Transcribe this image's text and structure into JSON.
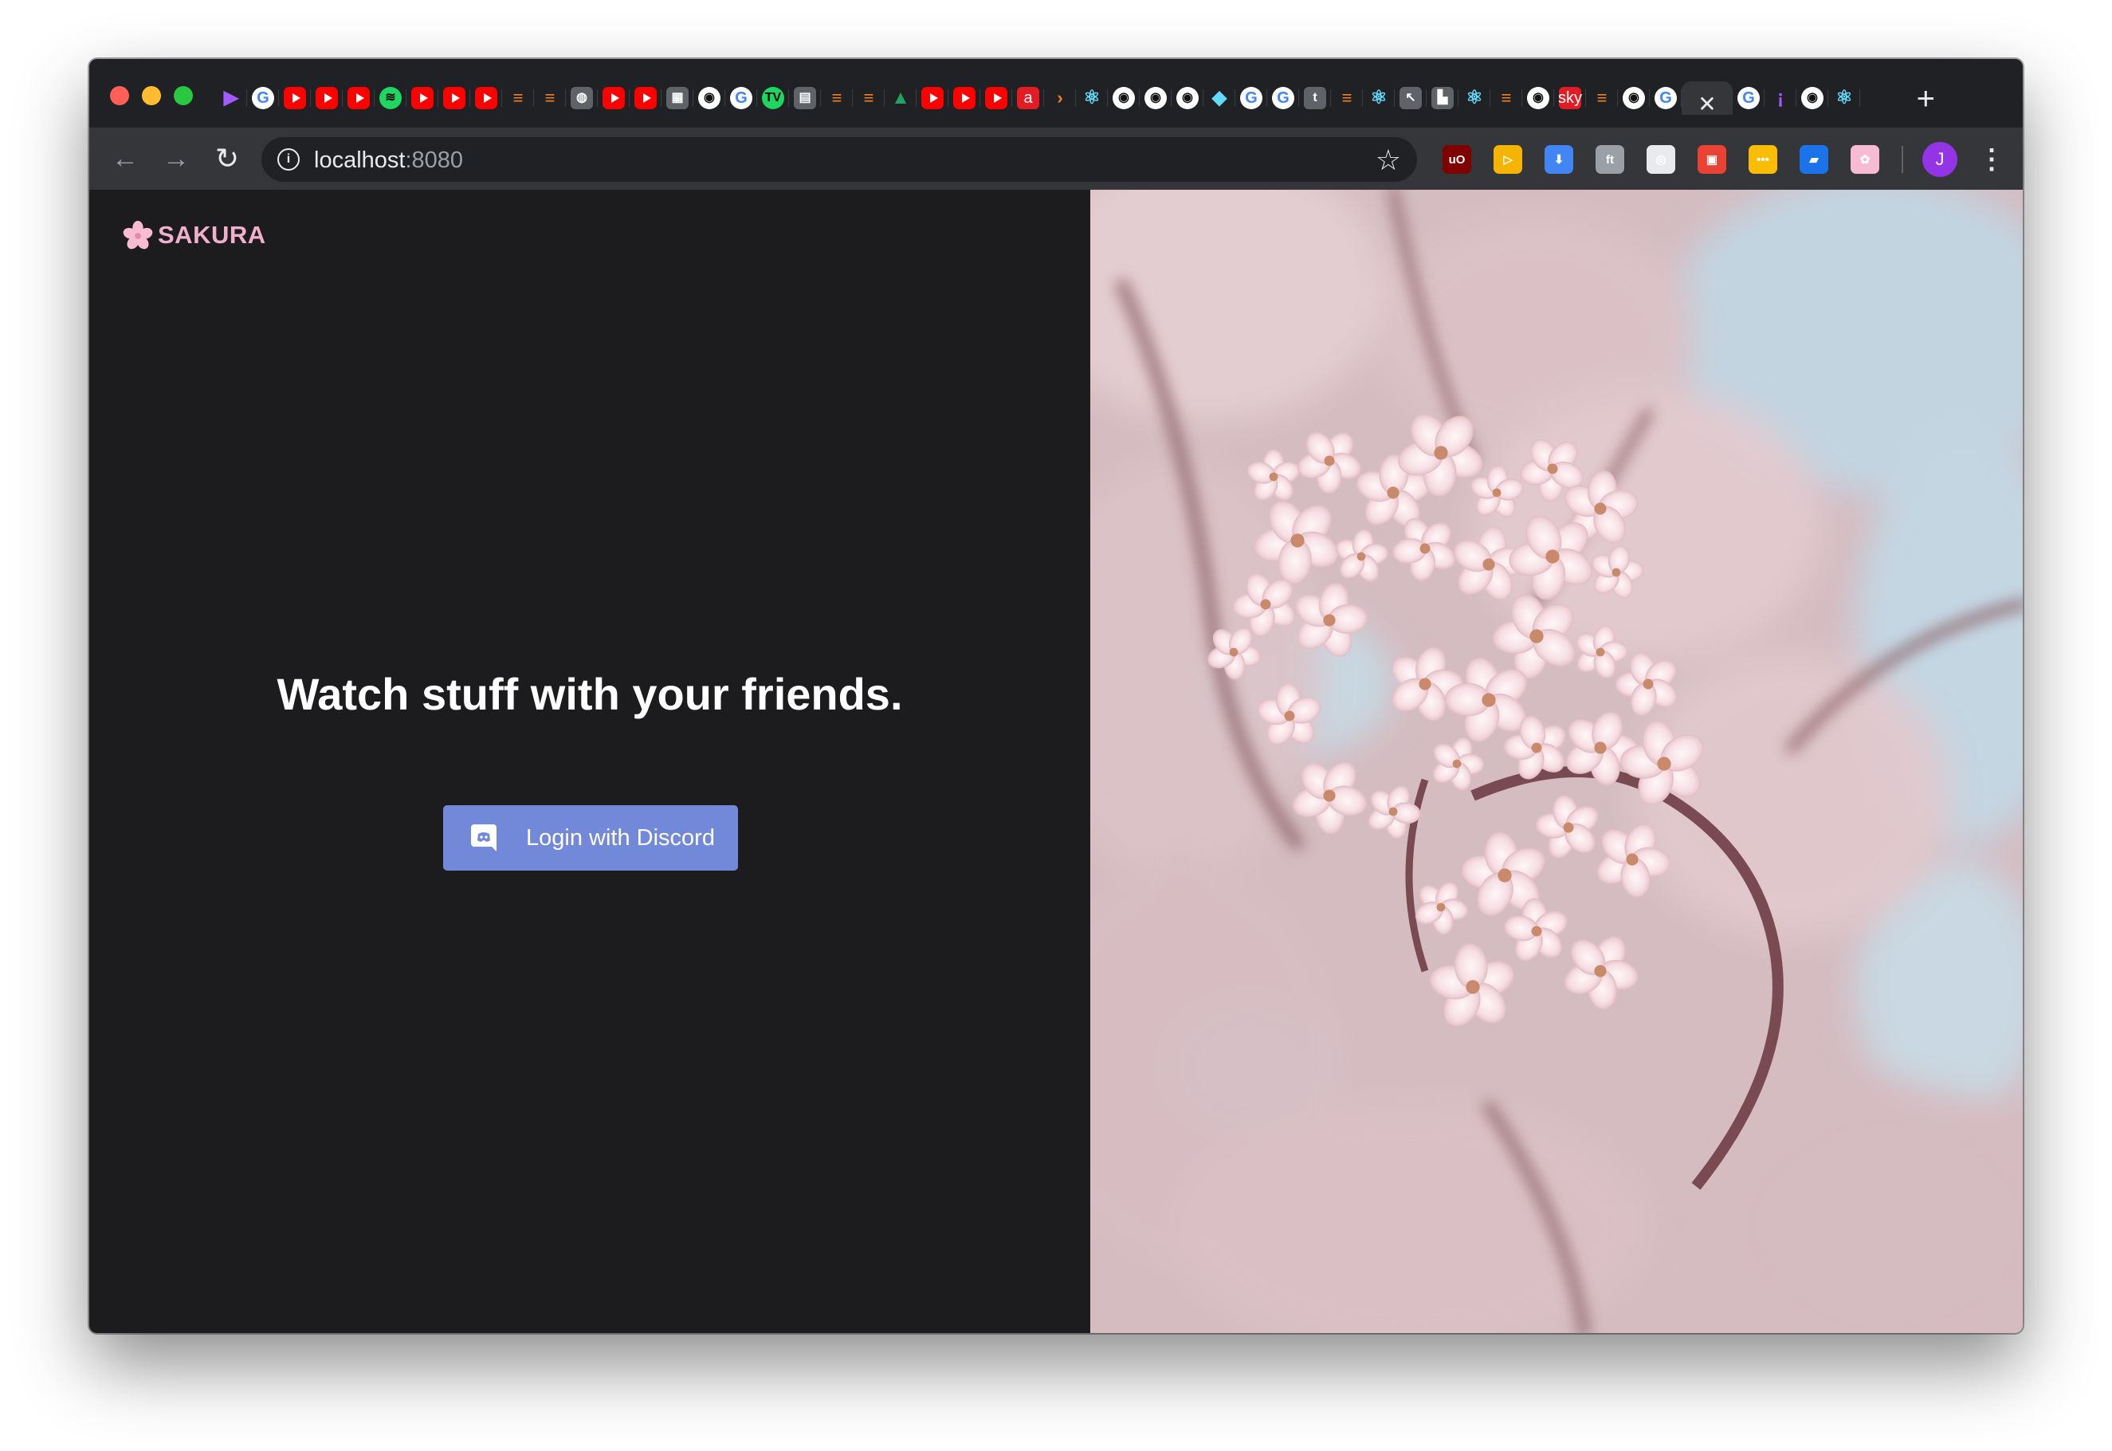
{
  "browser": {
    "tabs": [
      {
        "icon": "play-icon",
        "glyph": "▶",
        "kind": "fav-play"
      },
      {
        "icon": "google-icon",
        "glyph": "G",
        "kind": "fav-g"
      },
      {
        "icon": "youtube-icon",
        "glyph": "",
        "kind": "fav-yt"
      },
      {
        "icon": "youtube-icon",
        "glyph": "",
        "kind": "fav-yt"
      },
      {
        "icon": "youtube-icon",
        "glyph": "",
        "kind": "fav-yt"
      },
      {
        "icon": "spotify-icon",
        "glyph": "≋",
        "kind": "fav-sp"
      },
      {
        "icon": "youtube-icon",
        "glyph": "",
        "kind": "fav-yt"
      },
      {
        "icon": "youtube-icon",
        "glyph": "",
        "kind": "fav-yt"
      },
      {
        "icon": "youtube-icon",
        "glyph": "",
        "kind": "fav-yt"
      },
      {
        "icon": "stackoverflow-icon",
        "glyph": "≡",
        "kind": "fav-so"
      },
      {
        "icon": "stackoverflow-icon",
        "glyph": "≡",
        "kind": "fav-so"
      },
      {
        "icon": "globe-icon",
        "glyph": "◍",
        "kind": "fav-grey"
      },
      {
        "icon": "youtube-icon",
        "glyph": "",
        "kind": "fav-yt"
      },
      {
        "icon": "youtube-icon",
        "glyph": "",
        "kind": "fav-yt"
      },
      {
        "icon": "grid-icon",
        "glyph": "▦",
        "kind": "fav-grey"
      },
      {
        "icon": "github-icon",
        "glyph": "◉",
        "kind": "fav-gh"
      },
      {
        "icon": "google-icon",
        "glyph": "G",
        "kind": "fav-g"
      },
      {
        "icon": "tv-icon",
        "glyph": "TV",
        "kind": "fav-sp"
      },
      {
        "icon": "cart-icon",
        "glyph": "▤",
        "kind": "fav-grey"
      },
      {
        "icon": "stackoverflow-icon",
        "glyph": "≡",
        "kind": "fav-so"
      },
      {
        "icon": "stackoverflow-icon",
        "glyph": "≡",
        "kind": "fav-so"
      },
      {
        "icon": "google-drive-icon",
        "glyph": "▲",
        "kind": "fav-drive"
      },
      {
        "icon": "youtube-icon",
        "glyph": "",
        "kind": "fav-yt"
      },
      {
        "icon": "youtube-icon",
        "glyph": "",
        "kind": "fav-yt"
      },
      {
        "icon": "youtube-icon",
        "glyph": "",
        "kind": "fav-yt"
      },
      {
        "icon": "amazon-icon",
        "glyph": "a",
        "kind": "fav-amz"
      },
      {
        "icon": "arrow-icon",
        "glyph": "›",
        "kind": "fav-so"
      },
      {
        "icon": "react-icon",
        "glyph": "⚛",
        "kind": "fav-react"
      },
      {
        "icon": "github-icon",
        "glyph": "◉",
        "kind": "fav-gh"
      },
      {
        "icon": "github-icon",
        "glyph": "◉",
        "kind": "fav-gh"
      },
      {
        "icon": "github-icon",
        "glyph": "◉",
        "kind": "fav-gh"
      },
      {
        "icon": "cube-icon",
        "glyph": "◆",
        "kind": "fav-react"
      },
      {
        "icon": "google-icon",
        "glyph": "G",
        "kind": "fav-g"
      },
      {
        "icon": "google-icon",
        "glyph": "G",
        "kind": "fav-g"
      },
      {
        "icon": "text-icon",
        "glyph": "t",
        "kind": "fav-grey"
      },
      {
        "icon": "stackoverflow-icon",
        "glyph": "≡",
        "kind": "fav-so"
      },
      {
        "icon": "react-icon",
        "glyph": "⚛",
        "kind": "fav-react"
      },
      {
        "icon": "cursor-icon",
        "glyph": "↖",
        "kind": "fav-grey"
      },
      {
        "icon": "document-icon",
        "glyph": "▙",
        "kind": "fav-grey"
      },
      {
        "icon": "react-icon",
        "glyph": "⚛",
        "kind": "fav-react"
      },
      {
        "icon": "stackoverflow-icon",
        "glyph": "≡",
        "kind": "fav-so"
      },
      {
        "icon": "github-icon",
        "glyph": "◉",
        "kind": "fav-gh"
      },
      {
        "icon": "sky-news-icon",
        "glyph": "sky",
        "kind": "fav-amz"
      },
      {
        "icon": "stackoverflow-icon",
        "glyph": "≡",
        "kind": "fav-so"
      },
      {
        "icon": "github-icon",
        "glyph": "◉",
        "kind": "fav-gh"
      },
      {
        "icon": "google-icon",
        "glyph": "G",
        "kind": "fav-g"
      }
    ],
    "active_tab_close": "✕",
    "tabs_after": [
      {
        "icon": "google-icon",
        "glyph": "G",
        "kind": "fav-g"
      },
      {
        "icon": "exclaim-icon",
        "glyph": "¡",
        "kind": "fav-play"
      },
      {
        "icon": "github-icon",
        "glyph": "◉",
        "kind": "fav-gh"
      },
      {
        "icon": "react-icon",
        "glyph": "⚛",
        "kind": "fav-react"
      }
    ],
    "new_tab_glyph": "+",
    "url_host": "localhost",
    "url_port": ":8080",
    "extensions": [
      {
        "icon": "ublock-icon",
        "glyph": "uO",
        "color": "#800000"
      },
      {
        "icon": "play-extension-icon",
        "glyph": "▷",
        "color": "#f4b400"
      },
      {
        "icon": "download-icon",
        "glyph": "⬇",
        "color": "#4285f4"
      },
      {
        "icon": "font-icon",
        "glyph": "ft",
        "color": "#9aa0a6"
      },
      {
        "icon": "crx-icon",
        "glyph": "◎",
        "color": "#e8eaed"
      },
      {
        "icon": "calendar-icon",
        "glyph": "▣",
        "color": "#ea4335"
      },
      {
        "icon": "keep-icon",
        "glyph": "•••",
        "color": "#fbbc04"
      },
      {
        "icon": "window-icon",
        "glyph": "▰",
        "color": "#1a73e8"
      },
      {
        "icon": "sakura-extension-icon",
        "glyph": "✿",
        "color": "#f7bcd1"
      }
    ],
    "profile_initial": "J",
    "menu_glyph": "⋮"
  },
  "page": {
    "brand_name": "SAKURA",
    "headline": "Watch stuff with your friends.",
    "login_button_label": "Login with Discord",
    "accent_color": "#7289da",
    "brand_color": "#f0b0cc"
  }
}
